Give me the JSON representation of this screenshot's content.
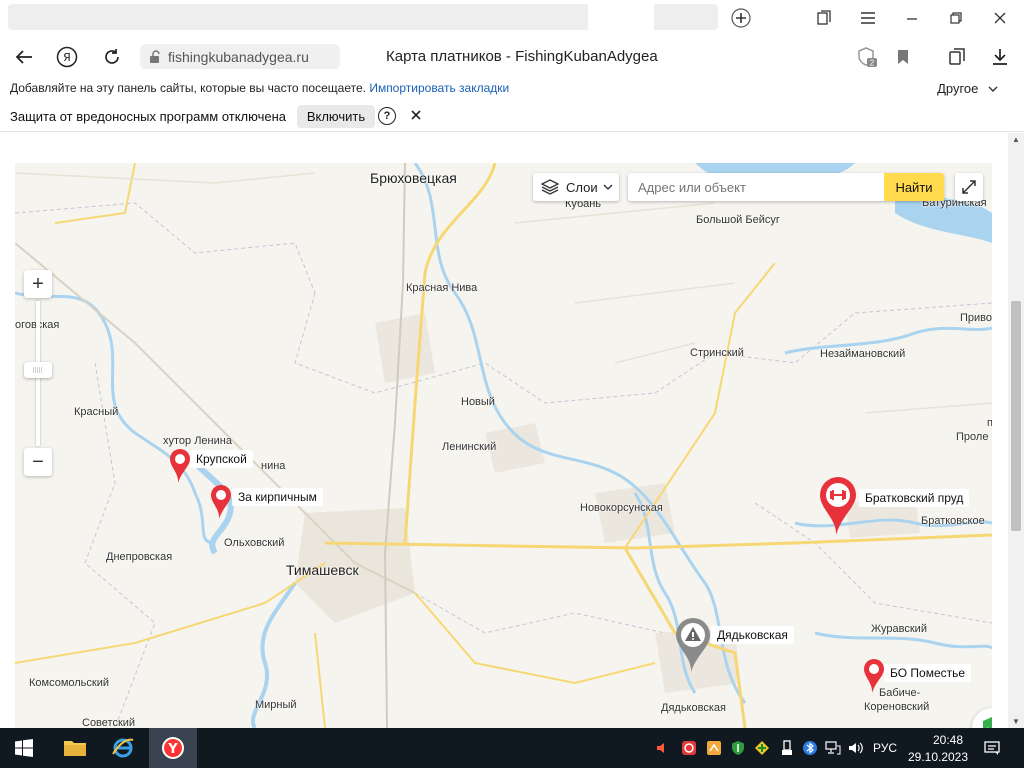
{
  "browser": {
    "url": "fishingkubanadygea.ru",
    "page_title": "Карта платников - FishingKubanAdygea",
    "badge_count": "2"
  },
  "bookmarks_bar": {
    "text": "Добавляйте на эту панель сайты, которые вы часто посещаете.",
    "import_link": "Импортировать закладки",
    "other": "Другое"
  },
  "warning_bar": {
    "text": "Защита от вредоносных программ отключена",
    "enable_button": "Включить",
    "help": "?"
  },
  "map": {
    "layers_button": "Слои",
    "search_placeholder": "Адрес или объект",
    "search_button": "Найти",
    "zoom_in": "+",
    "zoom_out": "−",
    "place_labels": {
      "bryukhovetskaya": "Брюховецкая",
      "kuban": "Кубань",
      "bolshoy_beysug": "Большой Бейсуг",
      "baturinskaya": "Батуринская",
      "krasnaya_niva": "Красная Нива",
      "ogovskaya": "оговская",
      "privo": "Приво",
      "strinsky": "Стринский",
      "nezaymanovsky": "Незаймановский",
      "krasny": "Красный",
      "novy": "Новый",
      "khutor_lenina": "хутор Ленина",
      "leninsky": "Ленинский",
      "prole": "Проле",
      "p": "п",
      "lenina2": "нина",
      "novokorsunskaya": "Новокорсунская",
      "bratkovskoe": "Братковское",
      "olkhovsky": "Ольховский",
      "dneprovskaya": "Днепровская",
      "timashevsk": "Тимашевск",
      "zhuravsky": "Журавский",
      "komsomolsky": "Комсомольский",
      "babiche": "Бабиче-",
      "korenovsky": "Кореновский",
      "sovetsky": "Советский",
      "mirny": "Мирный",
      "dyadkovskaya_town": "Дядьковская"
    },
    "placemarks": {
      "krupskoy": "Крупской",
      "za_kirpichnym": "За кирпичным",
      "bratkovsky_prud": "Братковский пруд",
      "dyadkovskaya": "Дядьковская",
      "bo_pomestye": "БО Поместье"
    },
    "colors": {
      "placemark_red": "#e8323b",
      "placemark_gray": "#8a8a8a",
      "water": "#a9d3ef",
      "road": "#f7d774",
      "search_button": "#ffdb4d"
    }
  },
  "taskbar": {
    "language": "РУС",
    "time": "20:48",
    "date": "29.10.2023"
  }
}
